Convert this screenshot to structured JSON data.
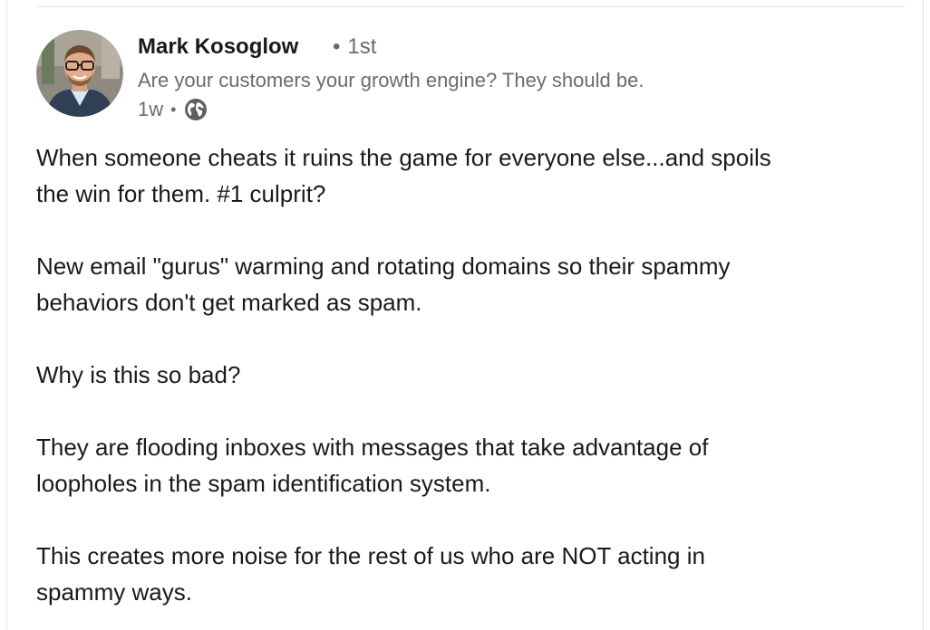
{
  "post": {
    "author": {
      "name": "Mark Kosoglow",
      "degree": "1st",
      "degree_separator": "•",
      "headline": "Are your customers your growth engine? They should be.",
      "avatar": "profile-photo"
    },
    "meta": {
      "age": "1w",
      "separator": "•",
      "visibility_icon": "globe-icon"
    },
    "paragraphs": [
      "When someone cheats it ruins the game for everyone else...and spoils\nthe win for them. #1 culprit?",
      "New email \"gurus\" warming and rotating domains so their spammy\nbehaviors don't get marked as spam.",
      "Why is this so bad?",
      "They are flooding inboxes with messages that take advantage of\nloopholes in the spam identification system.",
      "This creates more noise for the rest of us who are NOT acting in\nspammy ways."
    ]
  },
  "colors": {
    "text_primary": "#1a1a1a",
    "text_secondary": "#6b6b6b",
    "divider": "#e6e6e6",
    "background": "#ffffff"
  }
}
